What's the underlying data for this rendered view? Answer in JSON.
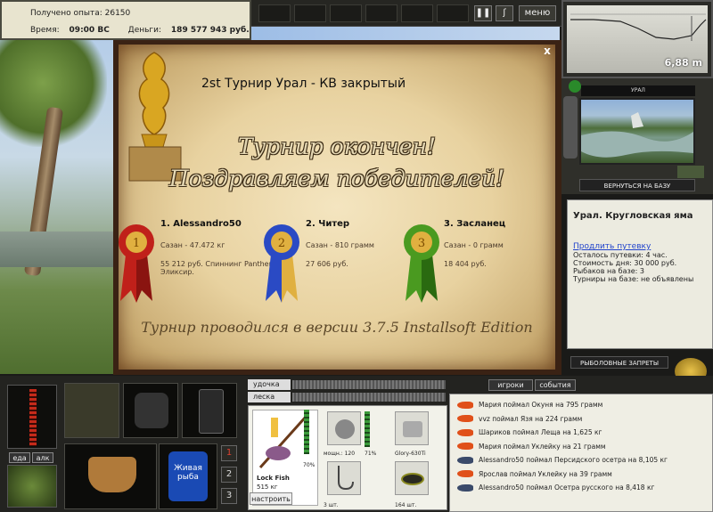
{
  "header": {
    "xp_label": "Получено опыта:",
    "xp_value": "26150",
    "time_label": "Время:",
    "time_value": "09:00 ВС",
    "money_label": "Деньги:",
    "money_value": "189 577 943 руб."
  },
  "topbar": {
    "pause_icon": "pause-icon",
    "hook_icon": "hook-icon",
    "menu_label": "меню"
  },
  "minimap": {
    "depth": "6,88 m"
  },
  "location": {
    "title": "УРАЛ",
    "return_button": "ВЕРНУТЬСЯ НА БАЗУ",
    "name": "Урал. Кругловская яма",
    "extend_link": "Продлить путевку",
    "remaining": "Осталось путевки: 4 час.",
    "cost": "Стоимость дня: 30 000 руб.",
    "anglers": "Рыбаков на базе: 3",
    "tournaments": "Турниры на базе: не объявлены",
    "bans_button": "РЫБОЛОВНЫЕ ЗАПРЕТЫ"
  },
  "tournament": {
    "close_label": "x",
    "title": "2st Турнир Урал - КВ закрытый",
    "finished": "Турнир окончен!",
    "congrats": "Поздравляем победителей!",
    "version_text": "Турнир проводился в версии 3.7.5 Installsoft Edition",
    "winners": [
      {
        "place": "1",
        "name": "1. Alessandro50",
        "catch": "Сазан - 47.472 кг",
        "prize": "55 212 руб. Спиннинг Panther Эликсир.",
        "color": "#c0201a"
      },
      {
        "place": "2",
        "name": "2. Читер",
        "catch": "Сазан - 810 грамм",
        "prize": "27 606 руб.",
        "color": "#2a4ac4"
      },
      {
        "place": "3",
        "name": "3. Засланец",
        "catch": "Сазан - 0 грамм",
        "prize": "18 404 руб.",
        "color": "#4a9a20"
      }
    ]
  },
  "bottom": {
    "eat_button": "еда",
    "alc_button": "алк",
    "bait_label": "Живая рыба",
    "slot_numbers": [
      "1",
      "2",
      "3"
    ],
    "rod_label": "удочка",
    "line_label": "леска",
    "fish_name": "Lock Fish",
    "fish_weight": "515 кг",
    "rod_percent": "70%",
    "reel_power": "мощн.: 120",
    "reel_percent": "71%",
    "line_name": "Glory-630Ti",
    "hooks_count": "3 шт.",
    "bait_count": "164 шт.",
    "setup_button": "настроить",
    "tab_players": "игроки",
    "tab_events": "события"
  },
  "chat": {
    "messages": [
      {
        "text": "Мария поймал Окуня на 795 грамм",
        "color": "#e0501a"
      },
      {
        "text": "vvz поймал Язя на 224 грамм",
        "color": "#e0501a"
      },
      {
        "text": "Шариков поймал Леща на 1,625 кг",
        "color": "#e0501a"
      },
      {
        "text": "Мария поймал Уклейку на 21 грамм",
        "color": "#e0501a"
      },
      {
        "text": "Alessandro50 поймал Персидского осетра на 8,105 кг",
        "color": "#3a4a6a"
      },
      {
        "text": "Ярослав поймал Уклейку на 39 грамм",
        "color": "#e0501a"
      },
      {
        "text": "Alessandro50 поймал Осетра русского на 8,418 кг",
        "color": "#3a4a6a"
      }
    ]
  }
}
